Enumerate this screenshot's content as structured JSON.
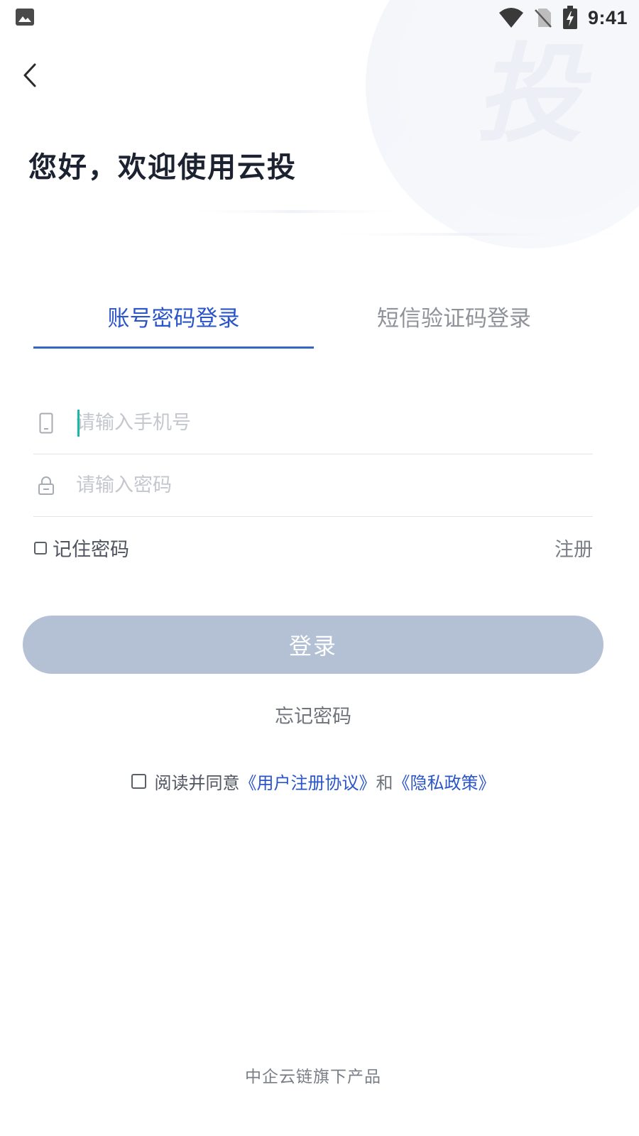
{
  "status_bar": {
    "time": "9:41",
    "icons": [
      "image-icon",
      "wifi-icon",
      "no-sim-icon",
      "battery-charging-icon"
    ]
  },
  "header": {
    "back_icon": "chevron-left-icon",
    "title": "您好，欢迎使用云投",
    "watermark": "投"
  },
  "tabs": [
    {
      "label": "账号密码登录",
      "active": true
    },
    {
      "label": "短信验证码登录",
      "active": false
    }
  ],
  "form": {
    "phone": {
      "placeholder": "请输入手机号",
      "value": "",
      "icon": "phone-icon"
    },
    "password": {
      "placeholder": "请输入密码",
      "value": "",
      "icon": "lock-icon"
    },
    "remember_label": "记住密码",
    "register_label": "注册",
    "login_button": "登录",
    "forgot_label": "忘记密码"
  },
  "agreement": {
    "prefix": "阅读并同意",
    "user_agreement": "《用户注册协议》",
    "and": "和",
    "privacy_policy": "《隐私政策》"
  },
  "footer": {
    "text": "中企云链旗下产品"
  },
  "colors": {
    "accent": "#2a55c9",
    "button_disabled": "#b4c1d4",
    "caret": "#19b8a6"
  }
}
